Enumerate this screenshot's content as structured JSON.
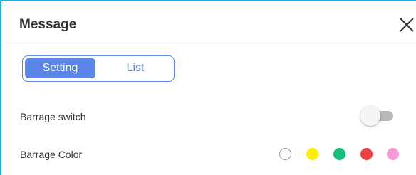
{
  "dialog": {
    "title": "Message",
    "close_icon": "close-icon"
  },
  "tabs": [
    {
      "label": "Setting",
      "active": true
    },
    {
      "label": "List",
      "active": false
    }
  ],
  "barrage_switch": {
    "label": "Barrage switch",
    "on": false
  },
  "barrage_color": {
    "label": "Barrage Color",
    "options": [
      {
        "name": "white",
        "color": "#ffffff"
      },
      {
        "name": "yellow",
        "color": "#ffee00"
      },
      {
        "name": "green",
        "color": "#14c07a"
      },
      {
        "name": "red",
        "color": "#f04040"
      },
      {
        "name": "pink",
        "color": "#f59ad3"
      }
    ]
  },
  "colors": {
    "accent": "#5b86e8",
    "frame": "#29a8e0"
  }
}
